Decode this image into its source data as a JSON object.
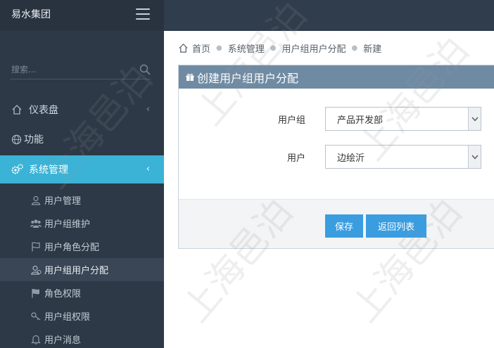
{
  "app": {
    "brand": "易水集团"
  },
  "sidebar": {
    "search_placeholder": "搜索...",
    "items": [
      {
        "label": "仪表盘",
        "icon": "home-icon",
        "chevron": "‹"
      },
      {
        "label": "功能",
        "icon": "globe-icon"
      },
      {
        "label": "系统管理",
        "icon": "gears-icon",
        "chevron": "‹"
      }
    ],
    "subitems": [
      {
        "label": "用户管理",
        "icon": "user-icon"
      },
      {
        "label": "用户组维护",
        "icon": "users-icon"
      },
      {
        "label": "用户角色分配",
        "icon": "flag-outline-icon"
      },
      {
        "label": "用户组用户分配",
        "icon": "user-group-icon"
      },
      {
        "label": "角色权限",
        "icon": "flag-icon"
      },
      {
        "label": "用户组权限",
        "icon": "key-icon"
      },
      {
        "label": "用户消息",
        "icon": "bell-icon"
      }
    ]
  },
  "breadcrumb": [
    "首页",
    "系统管理",
    "用户组用户分配",
    "新建"
  ],
  "panel": {
    "title": "创建用户组用户分配",
    "fields": [
      {
        "label": "用户组",
        "value": "产品开发部"
      },
      {
        "label": "用户",
        "value": "边绘沂"
      }
    ],
    "buttons": {
      "save": "保存",
      "back": "返回列表"
    }
  },
  "watermark": "上海邑泊",
  "colors": {
    "topbar": "#2f3d4c",
    "sidebar": "#2d3947",
    "accent": "#3ab3d6",
    "panel_head": "#6f8ba4",
    "button": "#3a9de0"
  }
}
